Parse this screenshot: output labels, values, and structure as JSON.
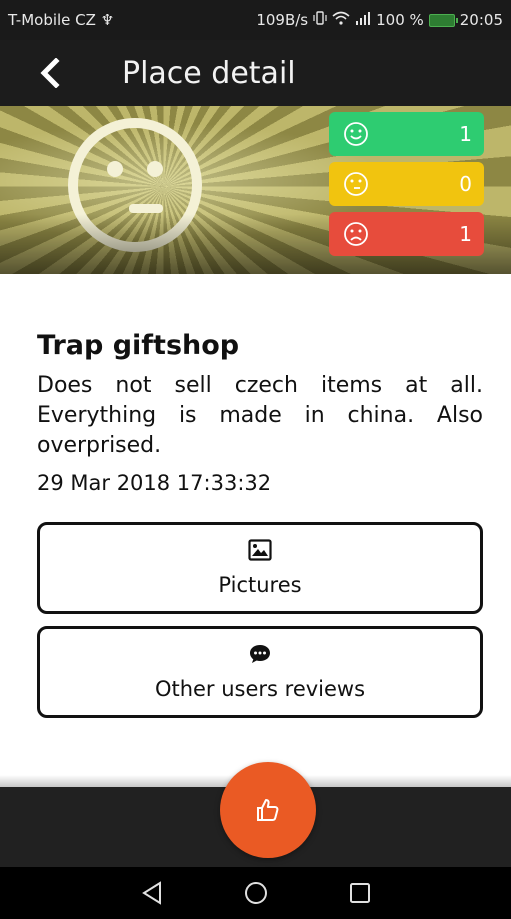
{
  "status_bar": {
    "carrier": "T-Mobile CZ",
    "usb_symbol": "♆",
    "net_speed": "109B/s",
    "battery_percent": "100 %",
    "time": "20:05"
  },
  "app_bar": {
    "title": "Place detail",
    "back_icon": "chevron-left-icon"
  },
  "hero": {
    "mood_icon": "neutral-face-icon",
    "counters": [
      {
        "mood": "happy",
        "count": "1",
        "color": "#2ecc71"
      },
      {
        "mood": "neutral",
        "count": "0",
        "color": "#f1c40f"
      },
      {
        "mood": "sad",
        "count": "1",
        "color": "#e74c3c"
      }
    ]
  },
  "place": {
    "name": "Trap giftshop",
    "description": "Does not sell czech items at all. Everything is made in china. Also overprised.",
    "date": "29 Mar 2018 17:33:32"
  },
  "buttons": {
    "pictures": {
      "label": "Pictures",
      "icon": "image-icon"
    },
    "reviews": {
      "label": "Other users reviews",
      "icon": "comment-dots-icon"
    }
  },
  "fab": {
    "icon": "thumbs-up-icon",
    "color": "#ea5a24"
  },
  "nav": {
    "back": "triangle-back-icon",
    "home": "circle-home-icon",
    "recents": "square-recents-icon"
  }
}
